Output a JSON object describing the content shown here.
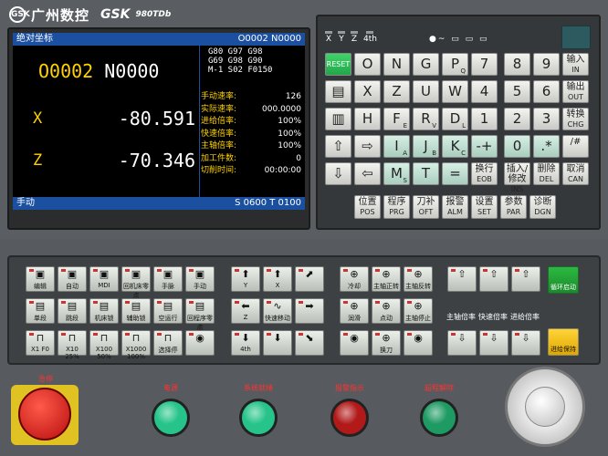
{
  "brand": {
    "logo": "GSK",
    "name": "广州数控",
    "gsk": "GSK",
    "model": "980TDb"
  },
  "screen": {
    "title_left": "绝对坐标",
    "title_right": "O0002 N0000",
    "program_o": "O0002",
    "program_n": "N0000",
    "axes": [
      {
        "name": "X",
        "value": "-80.591"
      },
      {
        "name": "Z",
        "value": "-70.346"
      }
    ],
    "gcodes": [
      "G80 G97 G98",
      "G69 G98 G90",
      "M-1 S02 F0150"
    ],
    "params": [
      {
        "label": "手动速率:",
        "value": "126"
      },
      {
        "label": "实际速率:",
        "value": "000.0000"
      },
      {
        "label": "进给倍率:",
        "value": "100%"
      },
      {
        "label": "快速倍率:",
        "value": "100%"
      },
      {
        "label": "主轴倍率:",
        "value": "100%"
      },
      {
        "label": "加工件数:",
        "value": "0"
      },
      {
        "label": "切削时间:",
        "value": "00:00:00"
      }
    ],
    "mode": "手动",
    "status": "S 0600  T 0100"
  },
  "indicators": [
    "X",
    "Y",
    "Z",
    "4th"
  ],
  "indicator_symbols": "●~ ▭ ▭ ▭",
  "keys": {
    "reset": "RESET",
    "row1": [
      {
        "m": "O",
        "s": ""
      },
      {
        "m": "N",
        "s": ""
      },
      {
        "m": "G",
        "s": ""
      },
      {
        "m": "P",
        "s": "Q"
      },
      {
        "m": "7",
        "s": ""
      },
      {
        "m": "8",
        "s": ""
      },
      {
        "m": "9",
        "s": ""
      }
    ],
    "row2": [
      {
        "m": "X",
        "s": ""
      },
      {
        "m": "Z",
        "s": ""
      },
      {
        "m": "U",
        "s": ""
      },
      {
        "m": "W",
        "s": ""
      },
      {
        "m": "4",
        "s": ""
      },
      {
        "m": "5",
        "s": ""
      },
      {
        "m": "6",
        "s": ""
      }
    ],
    "row3": [
      {
        "m": "H",
        "s": ""
      },
      {
        "m": "F",
        "s": "E"
      },
      {
        "m": "R",
        "s": "V"
      },
      {
        "m": "D",
        "s": "L"
      },
      {
        "m": "1",
        "s": ""
      },
      {
        "m": "2",
        "s": ""
      },
      {
        "m": "3",
        "s": ""
      }
    ],
    "row4": [
      {
        "m": "I",
        "s": "A"
      },
      {
        "m": "J",
        "s": "B"
      },
      {
        "m": "K",
        "s": "C"
      },
      {
        "m": "-+",
        "s": ""
      },
      {
        "m": "0",
        "s": ""
      },
      {
        "m": ".*",
        "s": ""
      }
    ],
    "row5": [
      {
        "m": "M",
        "s": "S"
      },
      {
        "m": "T",
        "s": ""
      },
      {
        "m": "=",
        "s": ""
      }
    ],
    "side": [
      {
        "cn": "输入",
        "en": "IN"
      },
      {
        "cn": "输出",
        "en": "OUT"
      },
      {
        "cn": "转换",
        "en": "CHG"
      },
      {
        "cn": "/#",
        "en": ""
      },
      {
        "cn": "取消",
        "en": "CAN"
      }
    ],
    "edit": [
      {
        "cn": "换行",
        "en": "EOB"
      },
      {
        "cn": "插入/修改",
        "en": "INS ALT"
      },
      {
        "cn": "删除",
        "en": "DEL"
      }
    ],
    "func": [
      {
        "cn": "位置",
        "en": "POS"
      },
      {
        "cn": "程序",
        "en": "PRG"
      },
      {
        "cn": "刀补",
        "en": "OFT"
      },
      {
        "cn": "报警",
        "en": "ALM"
      },
      {
        "cn": "设置",
        "en": "SET"
      },
      {
        "cn": "参数",
        "en": "PAR"
      },
      {
        "cn": "诊断",
        "en": "DGN"
      }
    ]
  },
  "ops": {
    "g1": [
      "编辑",
      "自动",
      "MDI",
      "回机床零点",
      "手脉",
      "手动"
    ],
    "g2": [
      "单段",
      "跳段",
      "机床锁",
      "辅助锁",
      "空运行",
      "回程序零点"
    ],
    "g3": [
      "X1 F0",
      "X10 25%",
      "X100 50%",
      "X1000 100%",
      "选择停"
    ],
    "axes": [
      "Y",
      "X",
      "Z",
      "快速移动",
      "4th"
    ],
    "spindle": [
      "冷却",
      "主轴正转",
      "润滑",
      "点动",
      "主轴停止",
      "换刀",
      "主轴反转"
    ],
    "override": [
      "主轴倍率",
      "快速倍率",
      "进给倍率"
    ],
    "green_box": "循环启动",
    "yellow_btn": "进给保持"
  },
  "lamps": [
    {
      "label": "电源",
      "color": "#26c48a"
    },
    {
      "label": "系统就绪",
      "color": "#26c48a"
    },
    {
      "label": "报警指示",
      "color": "#b21a1a"
    },
    {
      "label": "超程解除",
      "color": "#1e9a63"
    }
  ],
  "estop_label": "急停"
}
